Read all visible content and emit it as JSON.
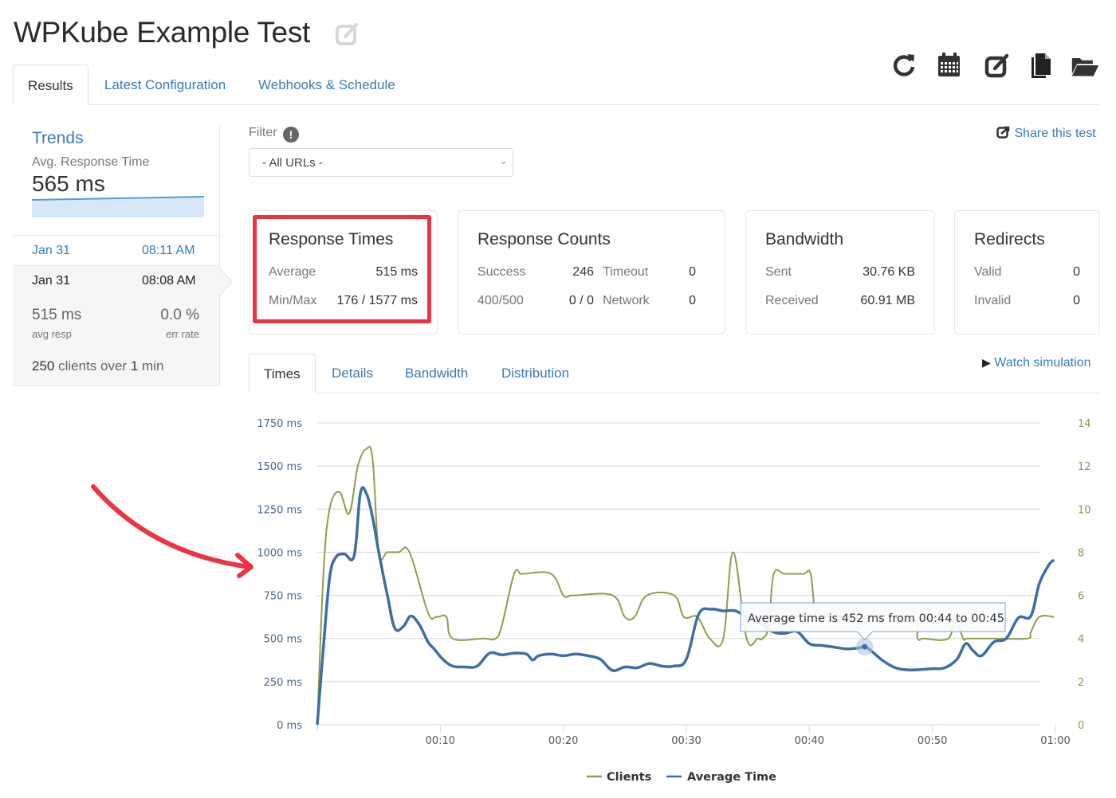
{
  "header": {
    "title": "WPKube Example Test",
    "tabs": [
      {
        "label": "Results",
        "active": true
      },
      {
        "label": "Latest Configuration",
        "active": false
      },
      {
        "label": "Webhooks & Schedule",
        "active": false
      }
    ],
    "toolbar_icons": [
      "refresh-icon",
      "calendar-icon",
      "edit-icon",
      "copy-icon",
      "folder-open-icon"
    ],
    "share_label": "Share this test"
  },
  "sidebar": {
    "heading": "Trends",
    "metric_label": "Avg. Response Time",
    "metric_value": "565 ms",
    "runs": [
      {
        "date": "Jan 31",
        "time": "08:11 AM",
        "selected": false
      },
      {
        "date": "Jan 31",
        "time": "08:08 AM",
        "selected": true
      }
    ],
    "selected_run": {
      "avg_resp_value": "515 ms",
      "avg_resp_label": "avg resp",
      "err_rate_value": "0.0 %",
      "err_rate_label": "err rate",
      "clients_count": "250",
      "clients_text": "clients over",
      "duration_count": "1",
      "duration_text": "min"
    }
  },
  "filter": {
    "label": "Filter",
    "selected": "- All URLs -"
  },
  "panels": {
    "response_times": {
      "title": "Response Times",
      "rows": [
        {
          "label": "Average",
          "value": "515 ms"
        },
        {
          "label": "Min/Max",
          "value": "176 / 1577 ms"
        }
      ]
    },
    "response_counts": {
      "title": "Response Counts",
      "rows": [
        {
          "label": "Success",
          "value": "246",
          "label2": "Timeout",
          "value2": "0"
        },
        {
          "label": "400/500",
          "value": "0 / 0",
          "label2": "Network",
          "value2": "0"
        }
      ]
    },
    "bandwidth": {
      "title": "Bandwidth",
      "rows": [
        {
          "label": "Sent",
          "value": "30.76 KB"
        },
        {
          "label": "Received",
          "value": "60.91 MB"
        }
      ]
    },
    "redirects": {
      "title": "Redirects",
      "rows": [
        {
          "label": "Valid",
          "value": "0"
        },
        {
          "label": "Invalid",
          "value": "0"
        }
      ]
    }
  },
  "chart_tabs": [
    {
      "label": "Times",
      "active": true
    },
    {
      "label": "Details",
      "active": false
    },
    {
      "label": "Bandwidth",
      "active": false
    },
    {
      "label": "Distribution",
      "active": false
    }
  ],
  "watch_simulation_label": "Watch simulation",
  "tooltip_text": "Average time is 452 ms from 00:44 to 00:45",
  "colors": {
    "clients": "#8aa14a",
    "average_time": "#3f6ea5",
    "link": "#3a7bb5",
    "highlight": "#ee3344"
  },
  "chart_data": {
    "type": "line",
    "title": "",
    "xlabel": "",
    "ylabel": "",
    "x_ticks": [
      "00:10",
      "00:20",
      "00:30",
      "00:40",
      "00:50",
      "01:00"
    ],
    "xlim_seconds": [
      0,
      60
    ],
    "y_left": {
      "ticks": [
        "0 ms",
        "250 ms",
        "500 ms",
        "750 ms",
        "1000 ms",
        "1250 ms",
        "1500 ms",
        "1750 ms"
      ],
      "range": [
        0,
        1750
      ]
    },
    "y_right": {
      "ticks": [
        "0",
        "2",
        "4",
        "6",
        "8",
        "10",
        "12",
        "14"
      ],
      "range": [
        0,
        14
      ]
    },
    "grid": true,
    "legend_position": "bottom",
    "series": [
      {
        "name": "Clients",
        "axis": "right",
        "x": [
          0,
          0.5,
          1,
          1.8,
          2.6,
          3.3,
          4,
          4.5,
          5,
          5.7,
          6.6,
          7.5,
          9,
          9.7,
          10.5,
          11,
          13.5,
          14.5,
          15,
          16,
          16.5,
          16.8,
          19,
          20,
          20.6,
          21,
          24,
          25,
          25.8,
          26.8,
          29,
          29.8,
          30.9,
          31.9,
          33,
          33.8,
          34.9,
          35.8,
          36.2,
          36.7,
          37.1,
          38,
          39.5,
          40.1,
          40.5,
          41,
          48,
          48.8,
          49.3,
          51.3,
          51.8,
          52.5,
          52.9,
          55,
          57.7,
          58,
          58.7,
          59.9
        ],
        "values": [
          0,
          7,
          10,
          10.8,
          9.8,
          12,
          12.8,
          12.3,
          8,
          8,
          8,
          8,
          5.2,
          5.0,
          5.0,
          4.0,
          4.0,
          4.0,
          4.6,
          7.0,
          7.0,
          7.0,
          7.0,
          6.0,
          6.0,
          6.0,
          6.0,
          5.0,
          5.0,
          6.0,
          6.0,
          5.0,
          5.0,
          4.0,
          4.0,
          8.0,
          4.0,
          4.0,
          4.0,
          4.6,
          7.0,
          7.0,
          7.0,
          7.0,
          5.0,
          5.0,
          5.0,
          4.0,
          4.0,
          4.0,
          5.0,
          4.0,
          4.0,
          4.0,
          4.0,
          4.3,
          5.0,
          5.0
        ]
      },
      {
        "name": "Average Time",
        "axis": "left",
        "x": [
          0,
          0.5,
          1,
          1.5,
          2.2,
          3,
          3.5,
          4,
          4.5,
          5,
          5.7,
          6.3,
          7,
          7.6,
          8.3,
          9,
          9.5,
          10.2,
          11,
          12,
          13,
          14,
          15,
          16,
          17,
          17.5,
          18,
          19,
          20,
          21,
          22,
          23,
          24,
          25,
          26,
          27,
          28,
          29,
          30,
          31,
          32,
          33,
          34,
          35,
          36,
          37,
          38,
          39,
          40,
          41,
          42,
          43,
          44,
          44.5,
          45,
          46,
          47,
          48,
          49,
          50,
          51,
          52,
          52.7,
          53.3,
          54,
          55,
          56,
          57,
          58,
          58.7,
          59.5,
          59.9
        ],
        "values": [
          0,
          450,
          850,
          970,
          990,
          980,
          1340,
          1340,
          1200,
          1000,
          750,
          560,
          570,
          630,
          580,
          480,
          440,
          380,
          340,
          335,
          340,
          415,
          405,
          415,
          410,
          375,
          400,
          410,
          400,
          410,
          400,
          380,
          315,
          335,
          330,
          355,
          340,
          340,
          380,
          640,
          670,
          660,
          660,
          620,
          590,
          540,
          530,
          540,
          470,
          460,
          450,
          440,
          445,
          452,
          430,
          370,
          330,
          318,
          320,
          325,
          330,
          380,
          470,
          430,
          400,
          480,
          500,
          620,
          630,
          820,
          930,
          955
        ]
      }
    ],
    "tooltip": {
      "series": "Average Time",
      "x": 44.5,
      "value": 452
    }
  }
}
